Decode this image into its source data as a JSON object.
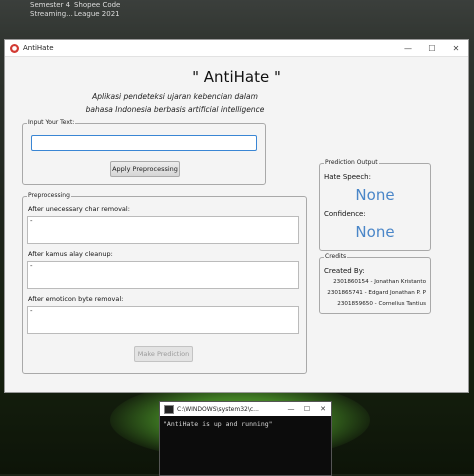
{
  "desktop": {
    "icon_labels": [
      "Semester 4",
      "Shopee Code",
      "Streaming...",
      "League 2021"
    ]
  },
  "window": {
    "title": "AntiHate",
    "icon_text": "●",
    "min_glyph": "—",
    "max_glyph": "☐",
    "close_glyph": "✕"
  },
  "header": {
    "title": "\" AntiHate \"",
    "description_line1": "Aplikasi pendeteksi ujaran kebencian dalam",
    "description_line2": "bahasa Indonesia berbasis artificial intelligence"
  },
  "input_group": {
    "label": "Input Your Text:",
    "value": "",
    "apply_button": "Apply Preprocessing"
  },
  "preprocessing": {
    "label": "Preprocessing",
    "steps": [
      {
        "label": "After unecessary char removal:",
        "value": "-"
      },
      {
        "label": "After kamus alay cleanup:",
        "value": "-"
      },
      {
        "label": "After emoticon byte removal:",
        "value": "-"
      }
    ],
    "predict_button": "Make Prediction"
  },
  "prediction": {
    "label": "Prediction Output",
    "hate_label": "Hate Speech:",
    "hate_value": "None",
    "confidence_label": "Confidence:",
    "confidence_value": "None"
  },
  "credits": {
    "label": "Credits",
    "heading": "Created By:",
    "lines": [
      "2301860154 - Jonathan Kristanto",
      "2301865741 - Edgard Jonathan P. P",
      "2301859650 - Cornelius Tantius"
    ]
  },
  "console": {
    "title": "C:\\WINDOWS\\system32\\c...",
    "output": "\"AntiHate is up and running\"",
    "min_glyph": "—",
    "max_glyph": "☐",
    "close_glyph": "✕"
  },
  "colors": {
    "accent": "#3a86d4",
    "value_blue": "#4a86c8",
    "app_icon": "#d23a33"
  }
}
